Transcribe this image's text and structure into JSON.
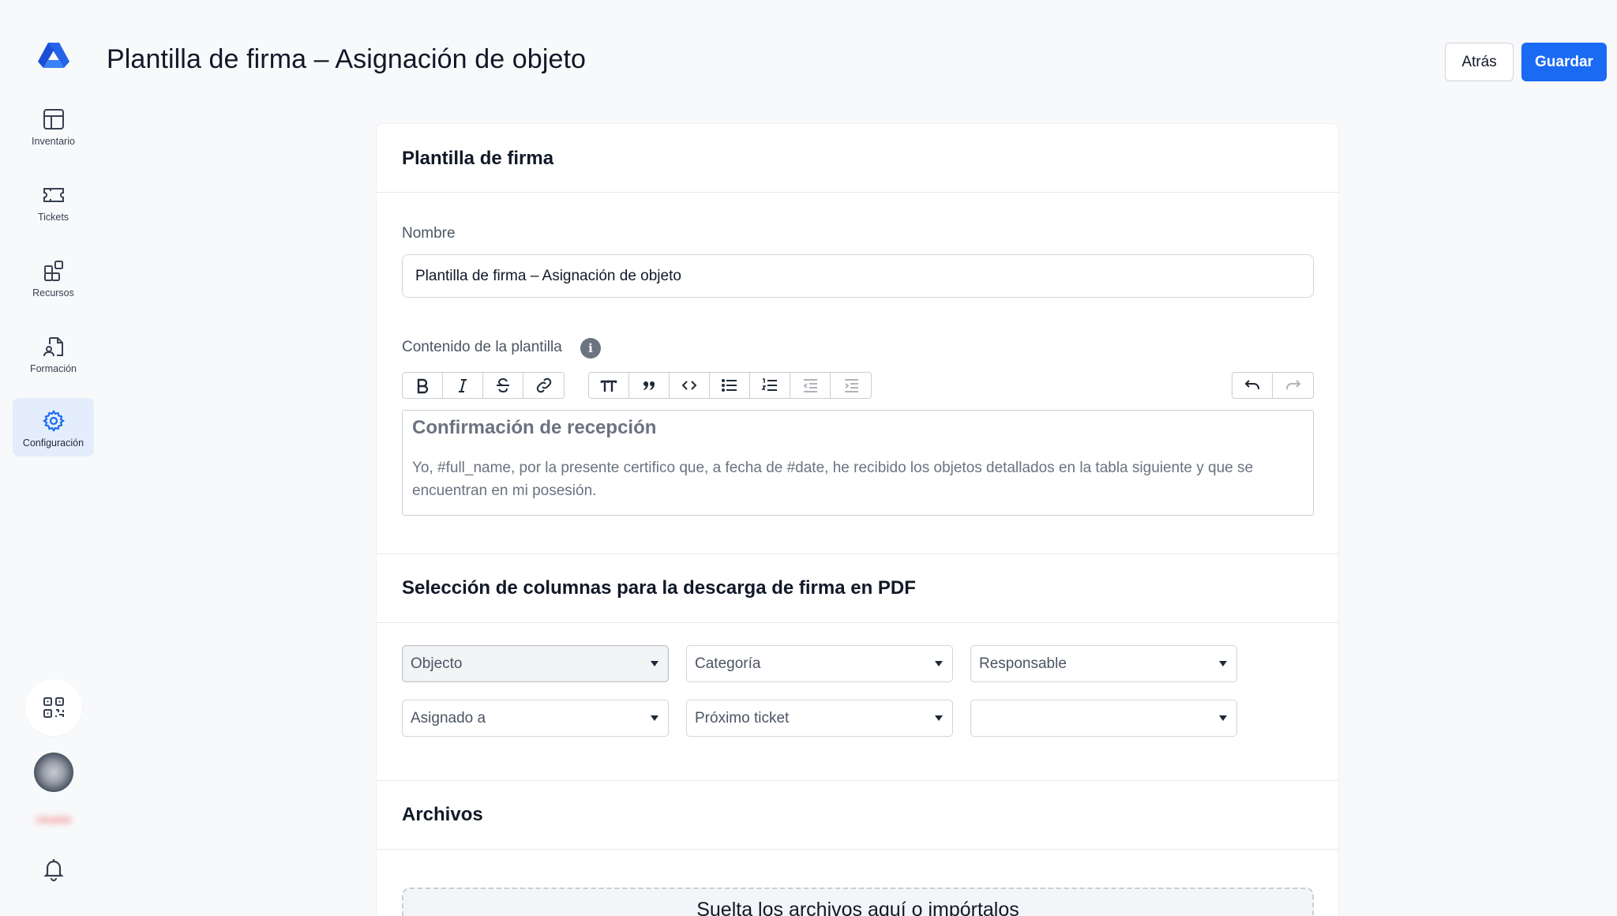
{
  "sidebar": {
    "items": [
      {
        "label": "Inventario",
        "icon": "table-icon"
      },
      {
        "label": "Tickets",
        "icon": "ticket-icon"
      },
      {
        "label": "Recursos",
        "icon": "shapes-icon"
      },
      {
        "label": "Formación",
        "icon": "document-user-icon"
      },
      {
        "label": "Configuración",
        "icon": "gear-icon",
        "active": true
      }
    ],
    "user_name": "Usuario"
  },
  "header": {
    "title": "Plantilla de firma – Asignación de objeto",
    "back_label": "Atrás",
    "save_label": "Guardar"
  },
  "template_section": {
    "title": "Plantilla de firma",
    "name_label": "Nombre",
    "name_value": "Plantilla de firma – Asignación de objeto",
    "content_label": "Contenido de la plantilla",
    "info_glyph": "i",
    "editor_heading": "Confirmación de recepción",
    "editor_body": "Yo, #full_name, por la presente certifico que, a fecha de #date, he recibido los objetos detallados en la tabla siguiente y que se encuentran en mi posesión."
  },
  "columns_section": {
    "title": "Selección de columnas para la descarga de firma en PDF",
    "selects": [
      "Objecto",
      "Categoría",
      "Responsable",
      "Asignado a",
      "Próximo ticket",
      ""
    ]
  },
  "files_section": {
    "title": "Archivos",
    "dropzone_text": "Suelta los archivos aquí o impórtalos"
  },
  "colors": {
    "primary": "#1a6af3",
    "active_nav_bg": "#e3edfc",
    "background": "#f8f9fb"
  }
}
